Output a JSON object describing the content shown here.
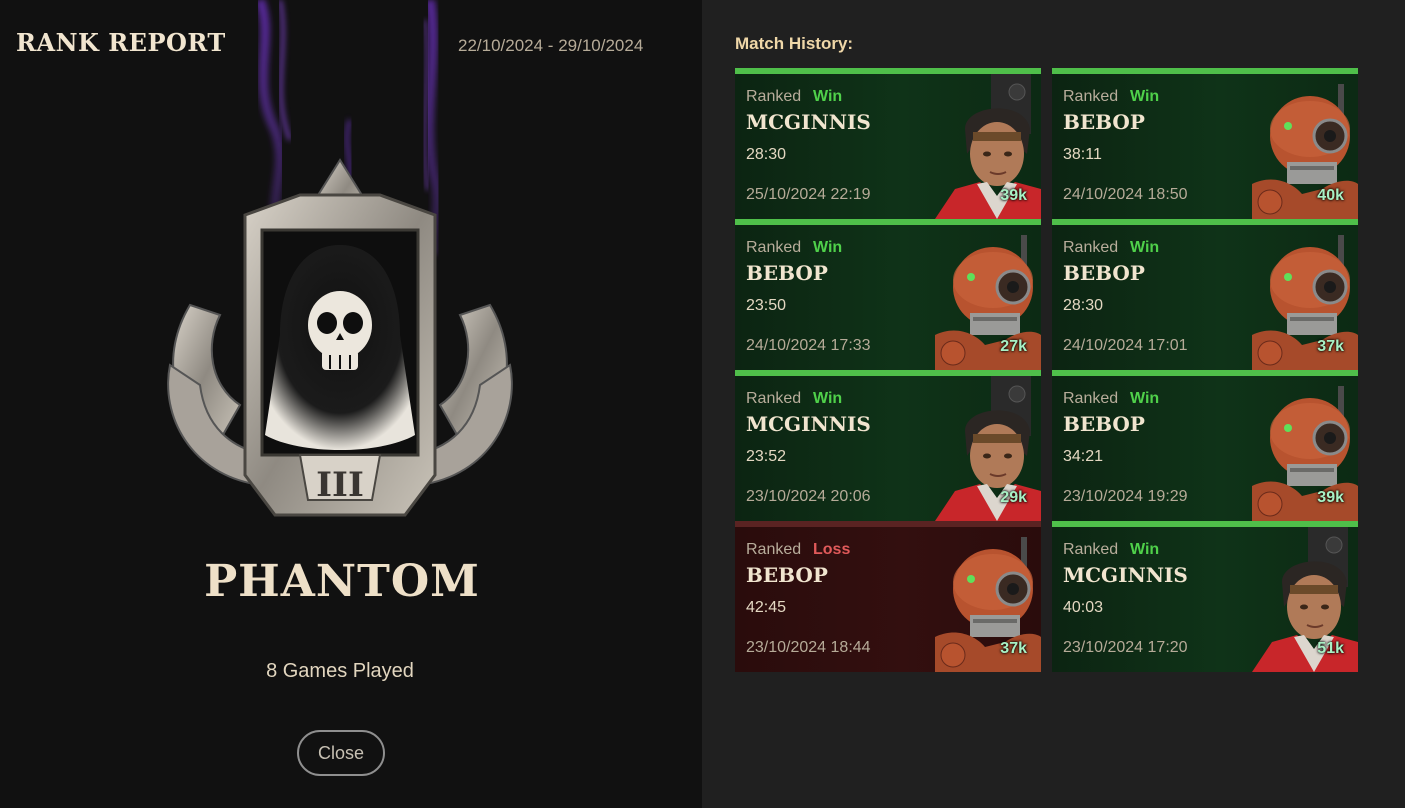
{
  "header": {
    "title": "RANK REPORT",
    "date_range": "22/10/2024 - 29/10/2024"
  },
  "rank": {
    "name": "PHANTOM",
    "tier": "III",
    "games_played": "8 Games Played"
  },
  "close_label": "Close",
  "match_history": {
    "title": "Match History:",
    "matches": [
      {
        "mode": "Ranked",
        "result": "Win",
        "hero": "MCGINNIS",
        "duration": "28:30",
        "date": "25/10/2024 22:19",
        "souls": "39k",
        "portrait": "mcginnis-portrait"
      },
      {
        "mode": "Ranked",
        "result": "Win",
        "hero": "BEBOP",
        "duration": "38:11",
        "date": "24/10/2024 18:50",
        "souls": "40k",
        "portrait": "bebop-portrait"
      },
      {
        "mode": "Ranked",
        "result": "Win",
        "hero": "BEBOP",
        "duration": "23:50",
        "date": "24/10/2024 17:33",
        "souls": "27k",
        "portrait": "bebop-portrait"
      },
      {
        "mode": "Ranked",
        "result": "Win",
        "hero": "BEBOP",
        "duration": "28:30",
        "date": "24/10/2024 17:01",
        "souls": "37k",
        "portrait": "bebop-portrait"
      },
      {
        "mode": "Ranked",
        "result": "Win",
        "hero": "MCGINNIS",
        "duration": "23:52",
        "date": "23/10/2024 20:06",
        "souls": "29k",
        "portrait": "mcginnis-portrait"
      },
      {
        "mode": "Ranked",
        "result": "Win",
        "hero": "BEBOP",
        "duration": "34:21",
        "date": "23/10/2024 19:29",
        "souls": "39k",
        "portrait": "bebop-portrait"
      },
      {
        "mode": "Ranked",
        "result": "Loss",
        "hero": "BEBOP",
        "duration": "42:45",
        "date": "23/10/2024 18:44",
        "souls": "37k",
        "portrait": "bebop-portrait"
      },
      {
        "mode": "Ranked",
        "result": "Win",
        "hero": "MCGINNIS",
        "duration": "40:03",
        "date": "23/10/2024 17:20",
        "souls": "51k",
        "portrait": "mcginnis-portrait"
      }
    ]
  },
  "colors": {
    "win_accent": "#4fbf4a",
    "loss_accent": "#e05a5a",
    "win_bg": "#0f3318",
    "loss_bg": "#330f0f",
    "smoke": "#7a3fd0"
  }
}
